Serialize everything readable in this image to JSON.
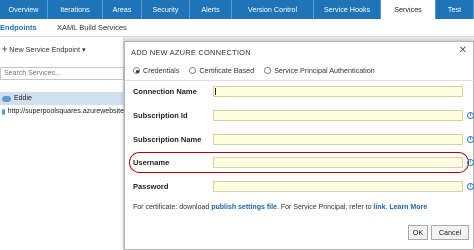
{
  "top_tabs": [
    "Overview",
    "Iterations",
    "Areas",
    "Security",
    "Alerts",
    "Version Control",
    "Service Hooks",
    "Services",
    "Test"
  ],
  "active_tab_index": 7,
  "sub_nav": {
    "endpoints": "Endpoints",
    "xaml": "XAML Build Services"
  },
  "left_panel": {
    "new_endpoint": "New Service Endpoint",
    "search_placeholder": "Search Services...",
    "services": [
      "Eddie",
      "http://superpoolsquares.azurewebsite"
    ]
  },
  "dialog": {
    "title": "ADD NEW AZURE CONNECTION",
    "radios": [
      "Credentials",
      "Certificate Based",
      "Service Principal Authentication"
    ],
    "selected_radio": 0,
    "fields": {
      "connection_name": "Connection Name",
      "subscription_id": "Subscription Id",
      "subscription_name": "Subscription Name",
      "username": "Username",
      "password": "Password"
    },
    "note_prefix": "For certificate: download ",
    "note_link1": "publish settings file",
    "note_middle": ". For Service Principal: refer to ",
    "note_link2": "link",
    "note_dot": ".",
    "note_link3": "Learn More",
    "ok_label": "OK",
    "cancel_label": "Cancel"
  },
  "colors": {
    "top_bar": "#1f73b7",
    "highlight": "#b00000",
    "input_bg": "#fffde0"
  }
}
